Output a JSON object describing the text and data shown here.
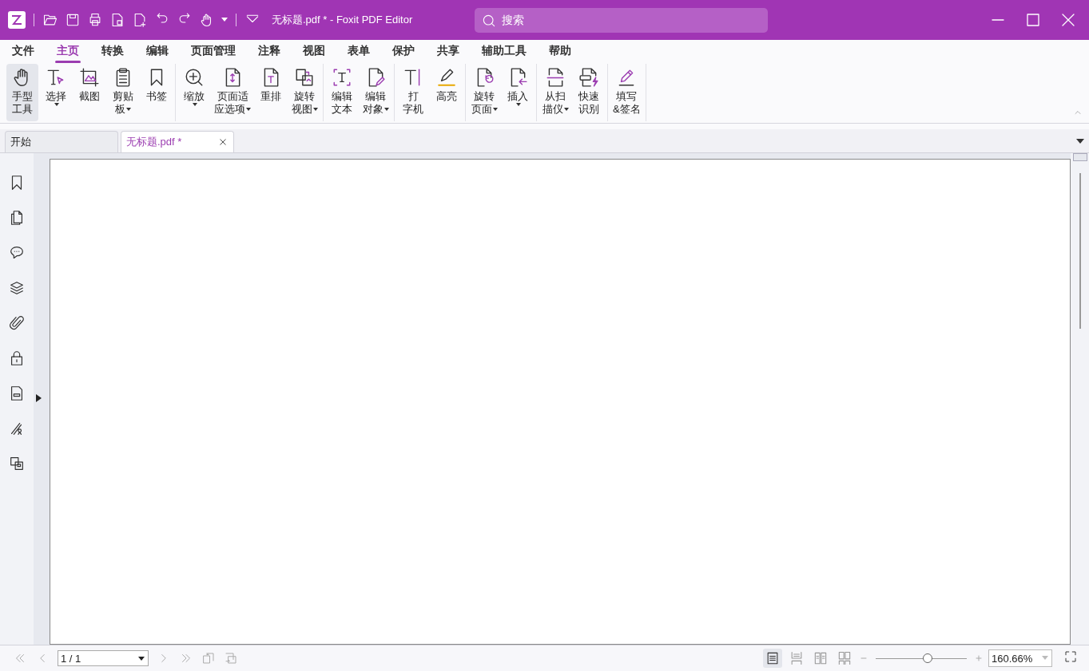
{
  "window": {
    "title": "无标题.pdf * - Foxit PDF Editor"
  },
  "search": {
    "placeholder": "搜索"
  },
  "menu_tabs": [
    {
      "label": "文件",
      "selected": false
    },
    {
      "label": "主页",
      "selected": true
    },
    {
      "label": "转换",
      "selected": false
    },
    {
      "label": "编辑",
      "selected": false
    },
    {
      "label": "页面管理",
      "selected": false
    },
    {
      "label": "注释",
      "selected": false
    },
    {
      "label": "视图",
      "selected": false
    },
    {
      "label": "表单",
      "selected": false
    },
    {
      "label": "保护",
      "selected": false
    },
    {
      "label": "共享",
      "selected": false
    },
    {
      "label": "辅助工具",
      "selected": false
    },
    {
      "label": "帮助",
      "selected": false
    }
  ],
  "ribbon_groups": [
    {
      "buttons": [
        {
          "lines": [
            "手型",
            "工具"
          ],
          "menu": false,
          "selected": true
        },
        {
          "lines": [
            "选择"
          ],
          "menu": true,
          "selected": false
        },
        {
          "lines": [
            "截图"
          ],
          "menu": false,
          "selected": false
        },
        {
          "lines": [
            "剪贴",
            "板"
          ],
          "menu": true,
          "selected": false
        },
        {
          "lines": [
            "书签"
          ],
          "menu": false,
          "selected": false
        }
      ]
    },
    {
      "buttons": [
        {
          "lines": [
            "缩放"
          ],
          "menu": true,
          "selected": false
        },
        {
          "lines": [
            "页面适",
            "应选项"
          ],
          "menu": true,
          "selected": false
        },
        {
          "lines": [
            "重排"
          ],
          "menu": false,
          "selected": false
        },
        {
          "lines": [
            "旋转",
            "视图"
          ],
          "menu": true,
          "selected": false
        }
      ]
    },
    {
      "buttons": [
        {
          "lines": [
            "编辑",
            "文本"
          ],
          "menu": false,
          "selected": false
        },
        {
          "lines": [
            "编辑",
            "对象"
          ],
          "menu": true,
          "selected": false
        }
      ]
    },
    {
      "buttons": [
        {
          "lines": [
            "打",
            "字机"
          ],
          "menu": false,
          "selected": false
        },
        {
          "lines": [
            "高亮"
          ],
          "menu": false,
          "selected": false
        }
      ]
    },
    {
      "buttons": [
        {
          "lines": [
            "旋转",
            "页面"
          ],
          "menu": true,
          "selected": false
        },
        {
          "lines": [
            "插入"
          ],
          "menu": true,
          "selected": false
        }
      ]
    },
    {
      "buttons": [
        {
          "lines": [
            "从扫",
            "描仪"
          ],
          "menu": true,
          "selected": false
        },
        {
          "lines": [
            "快速",
            "识别"
          ],
          "menu": false,
          "selected": false
        }
      ]
    },
    {
      "buttons": [
        {
          "lines": [
            "填写",
            "&签名"
          ],
          "menu": false,
          "selected": false
        }
      ]
    }
  ],
  "doc_tabs": [
    {
      "label": "开始",
      "selected": false,
      "closable": false
    },
    {
      "label": "无标题.pdf *",
      "selected": true,
      "closable": true
    }
  ],
  "status_bar": {
    "page": "1 / 1",
    "view_modes": [
      {
        "kind": "single",
        "selected": true
      },
      {
        "kind": "continuous",
        "selected": false
      },
      {
        "kind": "facing",
        "selected": false
      },
      {
        "kind": "facing-continuous",
        "selected": false
      }
    ],
    "zoom": {
      "level": 0.58,
      "value": "160.66%"
    }
  }
}
